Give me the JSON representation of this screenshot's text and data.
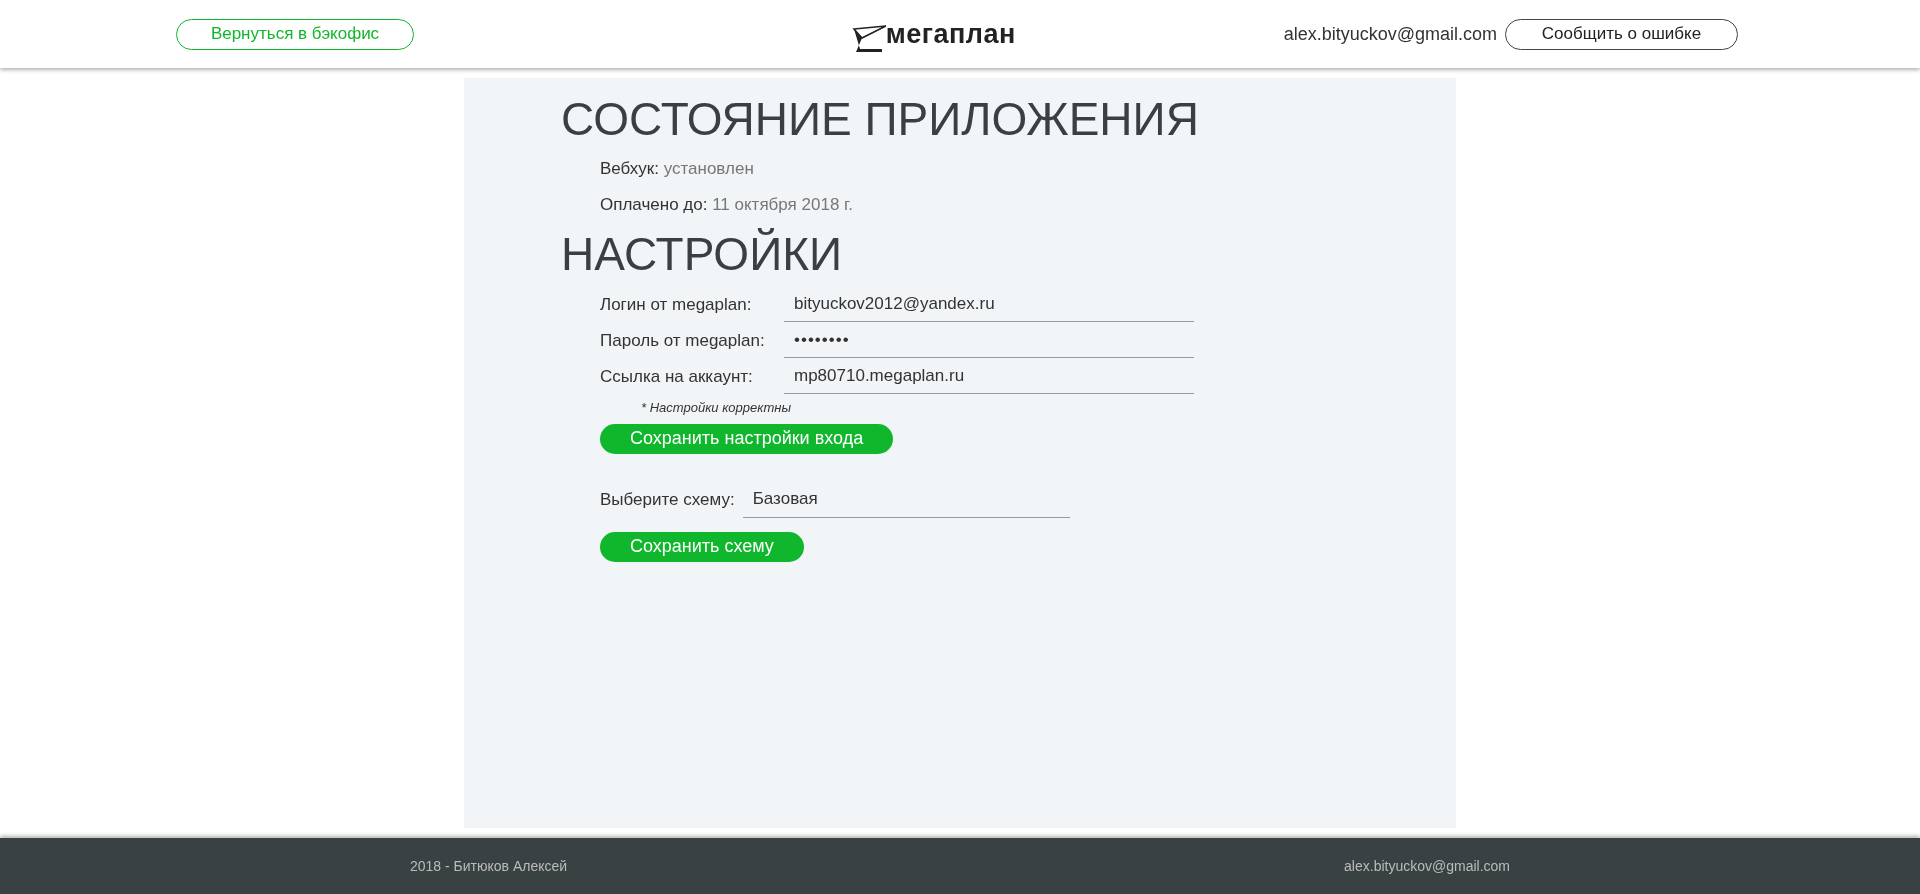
{
  "header": {
    "back_button": "Вернуться в бэкофис",
    "logo": "мегаплан",
    "user_email": "alex.bityuckov@gmail.com",
    "report_button": "Сообщить о ошибке"
  },
  "status": {
    "title": "СОСТОЯНИЕ ПРИЛОЖЕНИЯ",
    "items": [
      {
        "label": "Вебхук:",
        "value": "установлен"
      },
      {
        "label": "Оплачено до:",
        "value": "11 октября 2018 г."
      }
    ]
  },
  "settings": {
    "title": "НАСТРОЙКИ",
    "fields": [
      {
        "label": "Логин от megaplan:",
        "value": "bityuckov2012@yandex.ru",
        "kind": "text"
      },
      {
        "label": "Пароль от megaplan:",
        "value": "••••••••",
        "kind": "password"
      },
      {
        "label": "Ссылка на аккаунт:",
        "value": "mp80710.megaplan.ru",
        "kind": "text"
      }
    ],
    "note": "* Настройки корректны",
    "save_login_button": "Сохранить настройки входа",
    "scheme_label": "Выберите схему:",
    "scheme_value": "Базовая",
    "save_scheme_button": "Сохранить схему"
  },
  "footer": {
    "copyright": "2018 - Битюков Алексей",
    "email": "alex.bityuckov@gmail.com"
  }
}
